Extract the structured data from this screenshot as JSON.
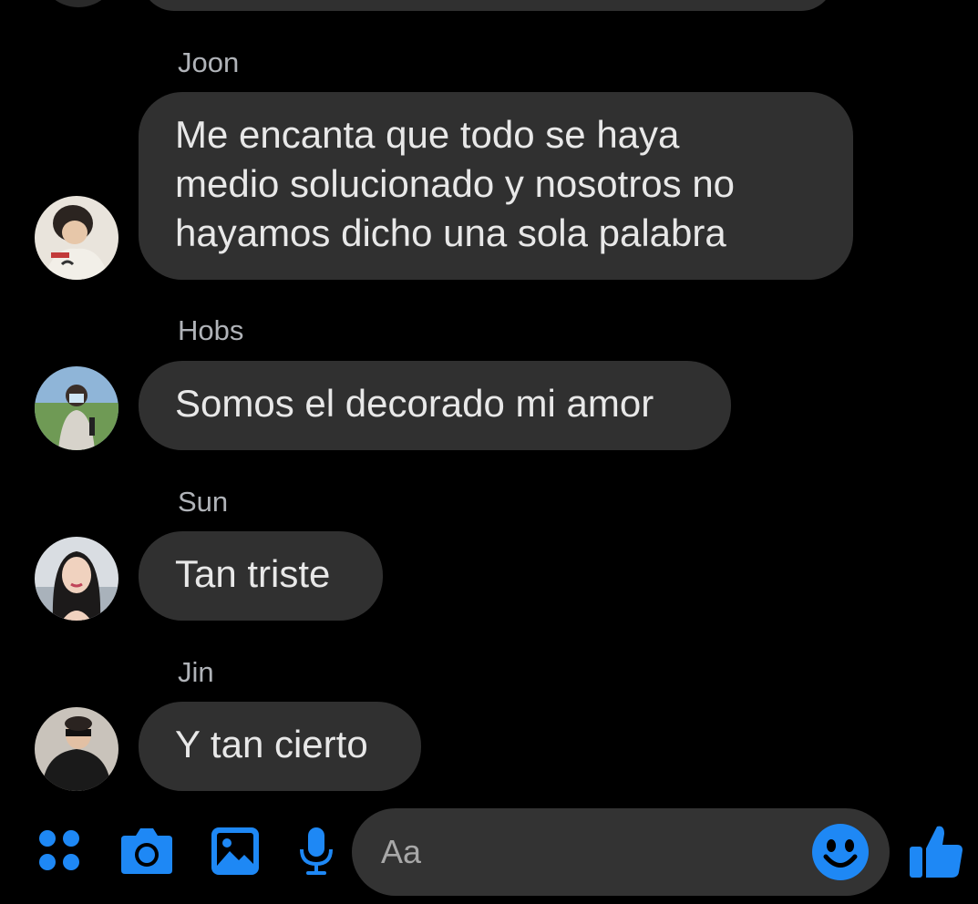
{
  "theme": {
    "background": "#000000",
    "bubble": "#303030",
    "accent": "#1e88f5",
    "sender_color": "#b0b3b8"
  },
  "messages": [
    {
      "sender": "Joon",
      "lines": [
        "Me encanta que todo se haya",
        "medio solucionado y nosotros no",
        "hayamos dicho una sola palabra"
      ],
      "avatar": "avatar-joon"
    },
    {
      "sender": "Hobs",
      "lines": [
        "Somos el decorado mi amor"
      ],
      "avatar": "avatar-hobs"
    },
    {
      "sender": "Sun",
      "lines": [
        "Tan triste"
      ],
      "avatar": "avatar-sun"
    },
    {
      "sender": "Jin",
      "lines": [
        "Y tan cierto"
      ],
      "avatar": "avatar-jin"
    }
  ],
  "composer": {
    "placeholder": "Aa",
    "icons": [
      "apps-icon",
      "camera-icon",
      "gallery-icon",
      "microphone-icon",
      "emoji-icon",
      "thumbs-up-icon"
    ]
  }
}
